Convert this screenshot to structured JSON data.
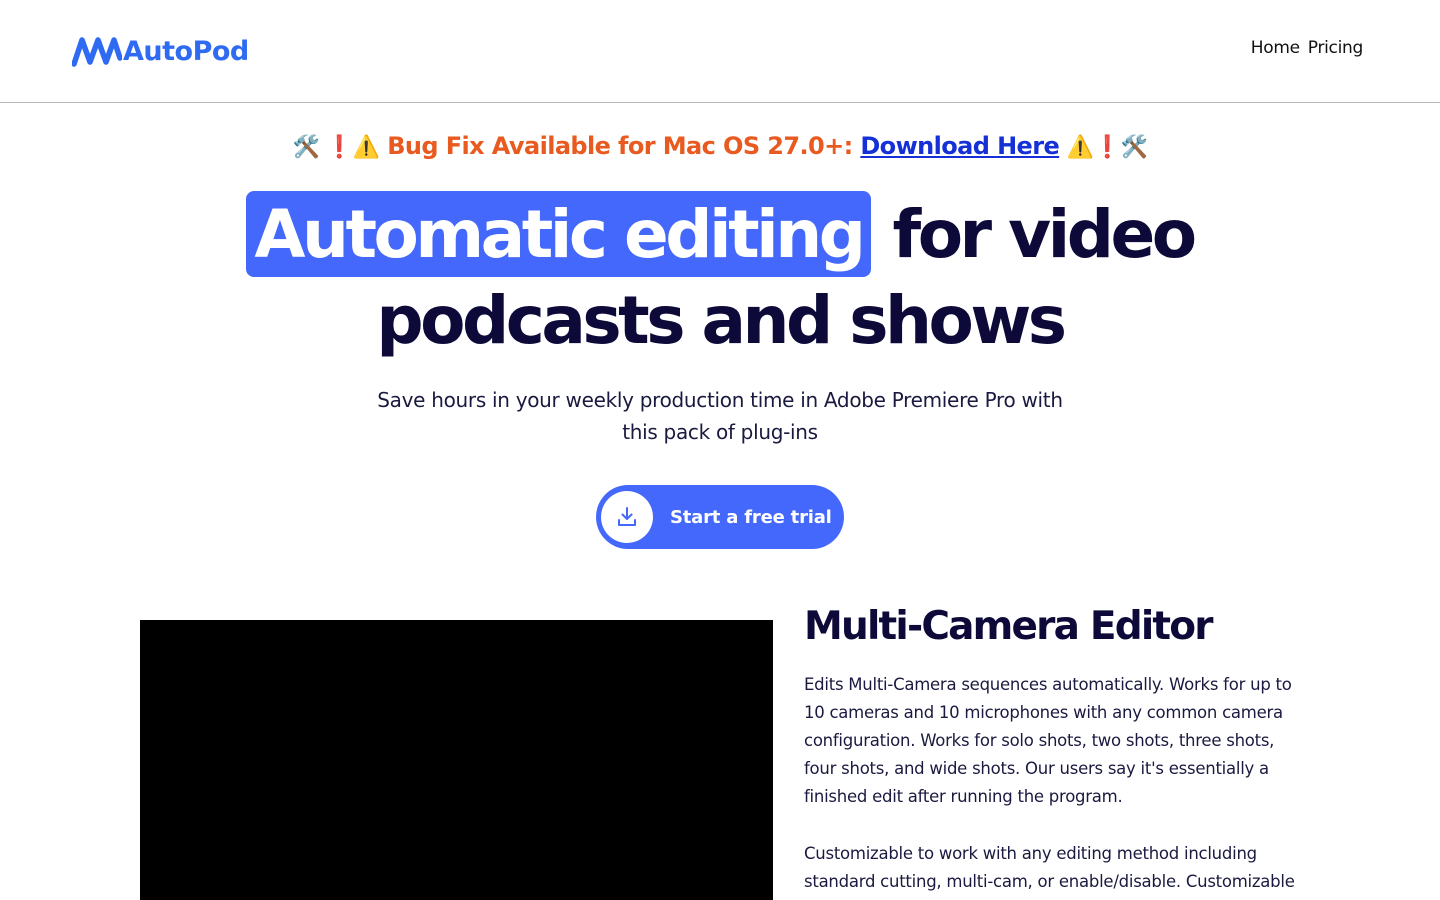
{
  "header": {
    "logo_text": "AutoPod",
    "nav": [
      {
        "label": "Home"
      },
      {
        "label": "Pricing"
      }
    ]
  },
  "announcement": {
    "emoji_left": "🛠️ ❗⚠️",
    "message": "Bug Fix Available for Mac OS 27.0+: ",
    "link_text": "Download Here",
    "emoji_right": "⚠️❗🛠️"
  },
  "hero": {
    "highlight": "Automatic editing",
    "title_rest": "for video",
    "title_line2": "podcasts and shows",
    "subtitle": "Save hours in your weekly production time in Adobe Premiere Pro with this pack of plug-ins",
    "cta_label": "Start a free trial",
    "cta_icon": "download-icon"
  },
  "feature": {
    "title": "Multi-Camera Editor",
    "paragraph1": "Edits Multi-Camera sequences automatically.  Works for up to 10 cameras and 10 microphones with any common camera configuration. Works for solo shots, two shots, three shots, four shots, and wide shots. Our users say it's essentially a finished edit after running the program.",
    "paragraph2": "Customizable to work with any editing method including standard cutting, multi-cam, or enable/disable.  Customizable"
  },
  "colors": {
    "brand_blue": "#4368fb",
    "logo_blue": "#2f6bf2",
    "heading_navy": "#0d0a3a",
    "alert_orange": "#e85a1f",
    "link_blue": "#1430d6"
  }
}
